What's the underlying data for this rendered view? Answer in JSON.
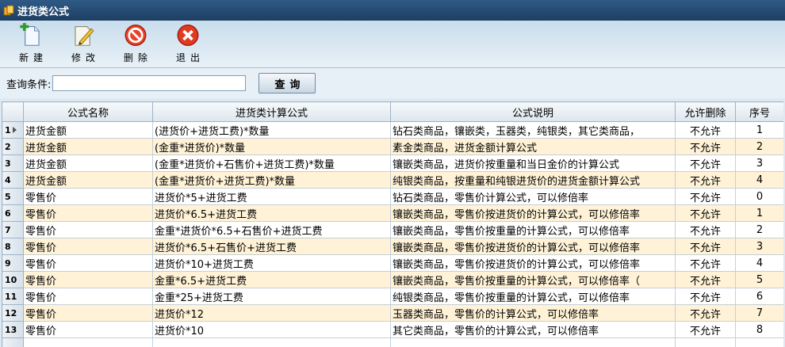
{
  "window": {
    "title": "进货类公式"
  },
  "toolbar": [
    {
      "label": "新建",
      "icon": "new-document-icon"
    },
    {
      "label": "修改",
      "icon": "edit-pencil-icon"
    },
    {
      "label": "删除",
      "icon": "delete-stop-icon"
    },
    {
      "label": "退出",
      "icon": "exit-x-icon"
    }
  ],
  "query": {
    "label": "查询条件:",
    "value": "",
    "button": "查询"
  },
  "grid": {
    "columns": [
      "公式名称",
      "进货类计算公式",
      "公式说明",
      "允许删除",
      "序号"
    ],
    "rows": [
      {
        "n": "1",
        "name": "进货金额",
        "formula": "(进货价+进货工费)*数量",
        "desc": "钻石类商品，镶嵌类，玉器类，纯银类，其它类商品，",
        "del": "不允许",
        "seq": "1"
      },
      {
        "n": "2",
        "name": "进货金额",
        "formula": "(金重*进货价)*数量",
        "desc": "素金类商品，进货金额计算公式",
        "del": "不允许",
        "seq": "2"
      },
      {
        "n": "3",
        "name": "进货金额",
        "formula": "(金重*进货价+石售价+进货工费)*数量",
        "desc": "镶嵌类商品，进货价按重量和当日金价的计算公式",
        "del": "不允许",
        "seq": "3"
      },
      {
        "n": "4",
        "name": "进货金额",
        "formula": "(金重*进货价+进货工费)*数量",
        "desc": "纯银类商品，按重量和纯银进货价的进货金额计算公式",
        "del": "不允许",
        "seq": "4"
      },
      {
        "n": "5",
        "name": "零售价",
        "formula": "进货价*5+进货工费",
        "desc": "钻石类商品，零售价计算公式，可以修倍率",
        "del": "不允许",
        "seq": "0"
      },
      {
        "n": "6",
        "name": "零售价",
        "formula": "进货价*6.5+进货工费",
        "desc": "镶嵌类商品，零售价按进货价的计算公式，可以修倍率",
        "del": "不允许",
        "seq": "1"
      },
      {
        "n": "7",
        "name": "零售价",
        "formula": "金重*进货价*6.5+石售价+进货工费",
        "desc": "镶嵌类商品，零售价按重量的计算公式，可以修倍率",
        "del": "不允许",
        "seq": "2"
      },
      {
        "n": "8",
        "name": "零售价",
        "formula": "进货价*6.5+石售价+进货工费",
        "desc": "镶嵌类商品，零售价按进货价的计算公式，可以修倍率",
        "del": "不允许",
        "seq": "3"
      },
      {
        "n": "9",
        "name": "零售价",
        "formula": "进货价*10+进货工费",
        "desc": "镶嵌类商品，零售价按进货价的计算公式，可以修倍率",
        "del": "不允许",
        "seq": "4"
      },
      {
        "n": "10",
        "name": "零售价",
        "formula": "金重*6.5+进货工费",
        "desc": "镶嵌类商品，零售价按重量的计算公式，可以修倍率（",
        "del": "不允许",
        "seq": "5"
      },
      {
        "n": "11",
        "name": "零售价",
        "formula": "金重*25+进货工费",
        "desc": "纯银类商品，零售价按重量的计算公式，可以修倍率",
        "del": "不允许",
        "seq": "6"
      },
      {
        "n": "12",
        "name": "零售价",
        "formula": "进货价*12",
        "desc": "玉器类商品，零售价的计算公式，可以修倍率",
        "del": "不允许",
        "seq": "7"
      },
      {
        "n": "13",
        "name": "零售价",
        "formula": "进货价*10",
        "desc": "其它类商品，零售价的计算公式，可以修倍率",
        "del": "不允许",
        "seq": "8"
      }
    ]
  }
}
